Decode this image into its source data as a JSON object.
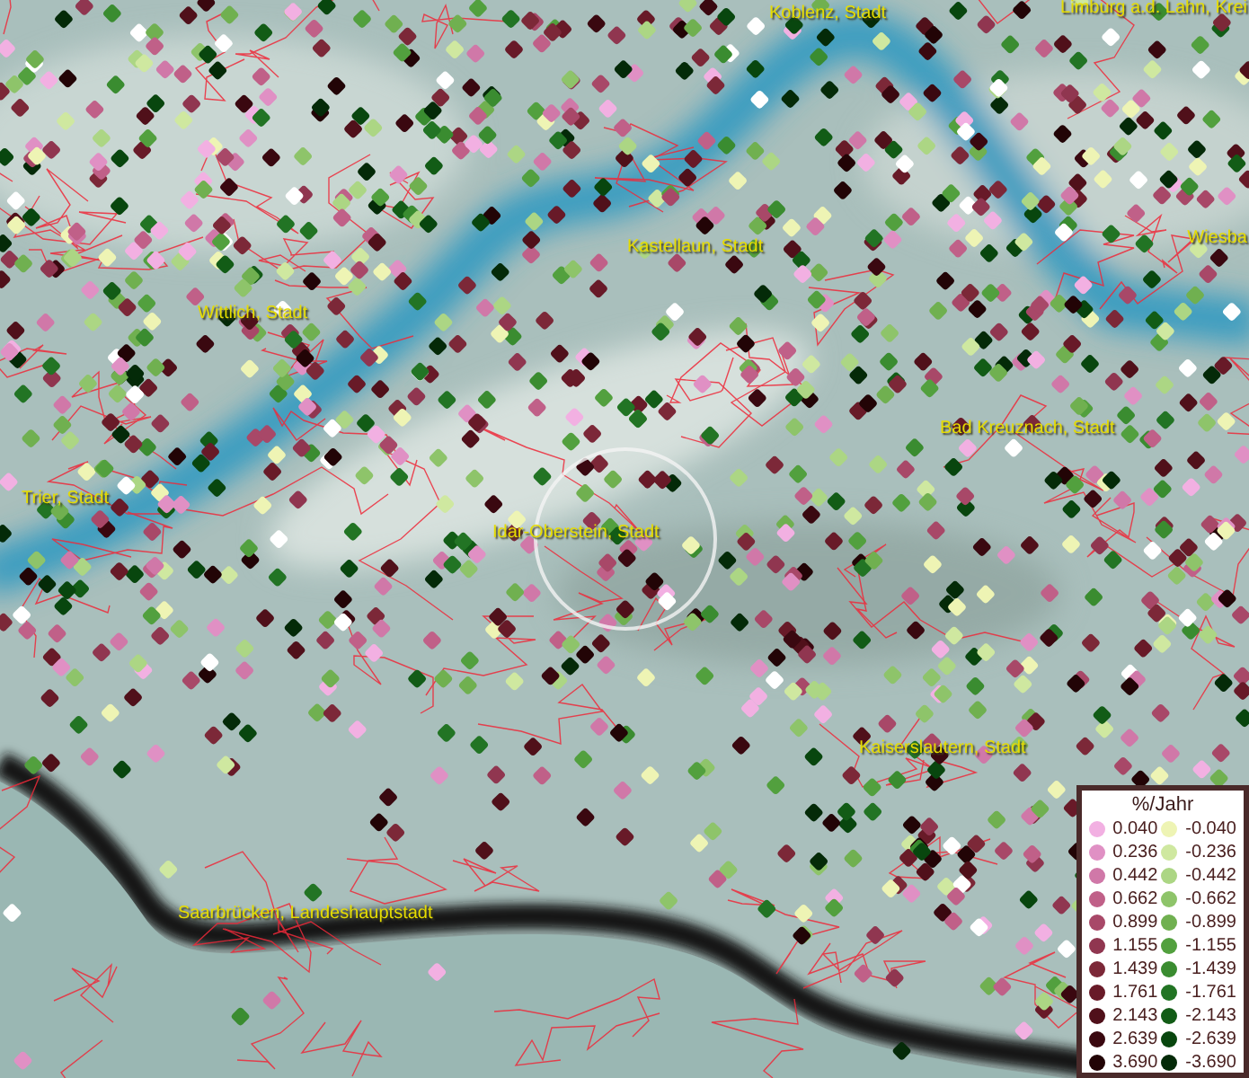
{
  "map": {
    "places": [
      {
        "name": "Koblenz, Stadt"
      },
      {
        "name": "Limburg a.d. Lahn, Krei"
      },
      {
        "name": "Wiesba"
      },
      {
        "name": "Kastellaun, Stadt"
      },
      {
        "name": "Wittlich, Stadt"
      },
      {
        "name": "Bad Kreuznach, Stadt"
      },
      {
        "name": "Trier, Stadt"
      },
      {
        "name": "Idar-Oberstein, Stadt"
      },
      {
        "name": "Kaiserslautern, Stadt"
      },
      {
        "name": "Saarbrücken, Landeshauptstadt"
      }
    ]
  },
  "legend": {
    "title": "%/Jahr",
    "rows": [
      {
        "positive": {
          "value": "0.040",
          "color": "#f2b0e2"
        },
        "negative": {
          "value": "-0.040",
          "color": "#eef4b4"
        }
      },
      {
        "positive": {
          "value": "0.236",
          "color": "#e090c4"
        },
        "negative": {
          "value": "-0.236",
          "color": "#cfe8a0"
        }
      },
      {
        "positive": {
          "value": "0.442",
          "color": "#d078a8"
        },
        "negative": {
          "value": "-0.442",
          "color": "#acd684"
        }
      },
      {
        "positive": {
          "value": "0.662",
          "color": "#c06088"
        },
        "negative": {
          "value": "-0.662",
          "color": "#8ec46a"
        }
      },
      {
        "positive": {
          "value": "0.899",
          "color": "#a84868"
        },
        "negative": {
          "value": "-0.899",
          "color": "#70b050"
        }
      },
      {
        "positive": {
          "value": "1.155",
          "color": "#903650"
        },
        "negative": {
          "value": "-1.155",
          "color": "#52a03e"
        }
      },
      {
        "positive": {
          "value": "1.439",
          "color": "#7c2838"
        },
        "negative": {
          "value": "-1.439",
          "color": "#3a8c30"
        }
      },
      {
        "positive": {
          "value": "1.761",
          "color": "#681a28"
        },
        "negative": {
          "value": "-1.761",
          "color": "#227424"
        }
      },
      {
        "positive": {
          "value": "2.143",
          "color": "#50101a"
        },
        "negative": {
          "value": "-2.143",
          "color": "#125c16"
        }
      },
      {
        "positive": {
          "value": "2.639",
          "color": "#3a0810"
        },
        "negative": {
          "value": "-2.639",
          "color": "#08460e"
        }
      },
      {
        "positive": {
          "value": "3.690",
          "color": "#220406"
        },
        "negative": {
          "value": "-3.690",
          "color": "#042a08"
        }
      }
    ]
  }
}
